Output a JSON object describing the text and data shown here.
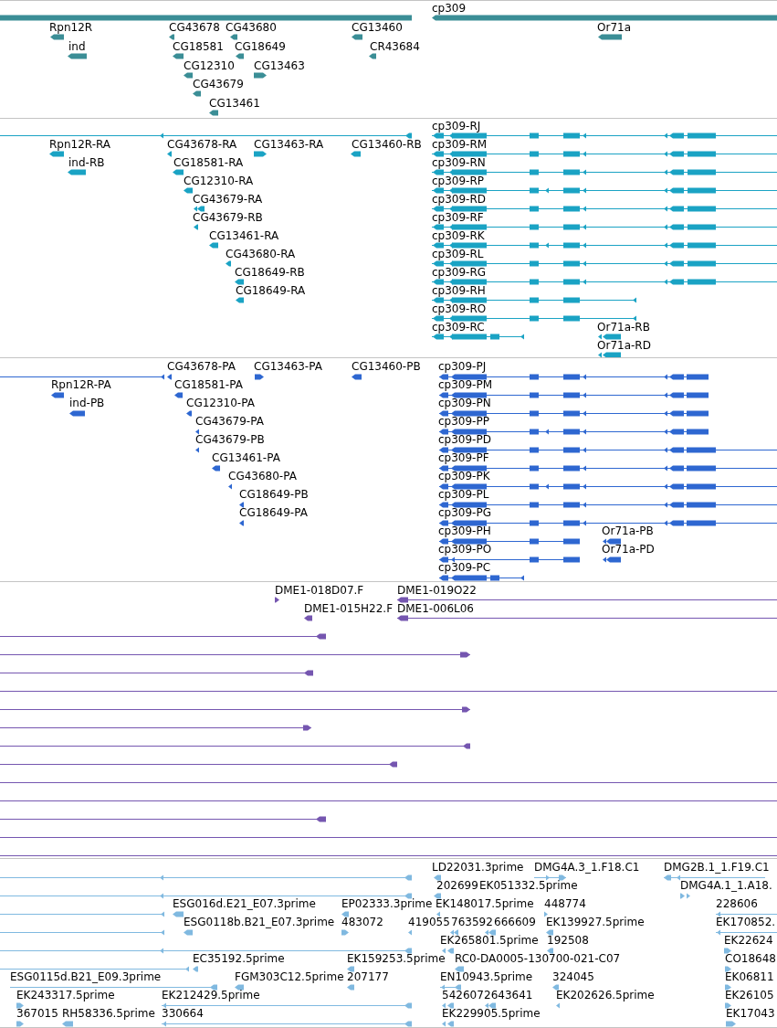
{
  "tracks": [
    {
      "color": "#3b8e96",
      "features": [
        {
          "clipped": true
        },
        {
          "label": "cp309",
          "reverse": true
        },
        {
          "label": "Rpn12R",
          "reverse": true
        },
        {
          "label": "CG43678",
          "reverse": true
        },
        {
          "label": "CG43680",
          "reverse": true
        },
        {
          "label": "CG13460",
          "reverse": true
        },
        {
          "label": "Or71a",
          "reverse": true
        },
        {
          "label": "ind",
          "reverse": true
        },
        {
          "label": "CG18581",
          "reverse": true
        },
        {
          "label": "CG18649",
          "reverse": true
        },
        {
          "label": "CR43684",
          "reverse": true
        },
        {
          "label": "CG12310",
          "reverse": true
        },
        {
          "label": "CG13463",
          "reverse": false
        },
        {
          "label": "CG43679",
          "reverse": true
        },
        {
          "label": "CG13461",
          "reverse": true
        }
      ]
    },
    {
      "color": "#1aa3c4",
      "features": [
        {
          "reverse": true
        },
        {
          "label": "cp309-RJ",
          "reverse": true
        },
        {
          "label": "Rpn12R-RA",
          "reverse": true
        },
        {
          "label": "CG43678-RA",
          "reverse": true
        },
        {
          "label": "CG13463-RA",
          "reverse": false
        },
        {
          "label": "CG13460-RB",
          "reverse": true
        },
        {
          "label": "cp309-RM",
          "reverse": true
        },
        {
          "label": "ind-RB",
          "reverse": true
        },
        {
          "label": "CG18581-RA",
          "reverse": true
        },
        {
          "label": "cp309-RN",
          "reverse": true
        },
        {
          "label": "CG12310-RA",
          "reverse": true
        },
        {
          "label": "cp309-RP",
          "reverse": true
        },
        {
          "label": "CG43679-RA",
          "reverse": true
        },
        {
          "label": "cp309-RD",
          "reverse": true
        },
        {
          "label": "CG43679-RB",
          "reverse": true
        },
        {
          "label": "cp309-RF",
          "reverse": true
        },
        {
          "label": "CG13461-RA",
          "reverse": true
        },
        {
          "label": "cp309-RK",
          "reverse": true
        },
        {
          "label": "CG43680-RA",
          "reverse": true
        },
        {
          "label": "cp309-RL",
          "reverse": true
        },
        {
          "label": "CG18649-RB",
          "reverse": true
        },
        {
          "label": "cp309-RG",
          "reverse": true
        },
        {
          "label": "CG18649-RA",
          "reverse": true
        },
        {
          "label": "cp309-RH",
          "reverse": true
        },
        {
          "label": "cp309-RO",
          "reverse": true
        },
        {
          "label": "cp309-RC",
          "reverse": true
        },
        {
          "label": "Or71a-RB",
          "reverse": true
        },
        {
          "label": "Or71a-RD",
          "reverse": true
        }
      ]
    },
    {
      "color": "#2e67d1",
      "features": [
        {
          "reverse": true
        },
        {
          "label": "CG43678-PA",
          "reverse": true
        },
        {
          "label": "CG13463-PA",
          "reverse": false
        },
        {
          "label": "CG13460-PB",
          "reverse": true
        },
        {
          "label": "cp309-PJ",
          "reverse": true
        },
        {
          "label": "Rpn12R-PA",
          "reverse": true
        },
        {
          "label": "CG18581-PA",
          "reverse": true
        },
        {
          "label": "cp309-PM",
          "reverse": true
        },
        {
          "label": "ind-PB",
          "reverse": true
        },
        {
          "label": "CG12310-PA",
          "reverse": true
        },
        {
          "label": "cp309-PN",
          "reverse": true
        },
        {
          "label": "CG43679-PA",
          "reverse": true
        },
        {
          "label": "cp309-PP",
          "reverse": true
        },
        {
          "label": "CG43679-PB",
          "reverse": true
        },
        {
          "label": "cp309-PD",
          "reverse": true
        },
        {
          "label": "CG13461-PA",
          "reverse": true
        },
        {
          "label": "cp309-PF",
          "reverse": true
        },
        {
          "label": "CG43680-PA",
          "reverse": true
        },
        {
          "label": "cp309-PK",
          "reverse": true
        },
        {
          "label": "CG18649-PB",
          "reverse": true
        },
        {
          "label": "cp309-PL",
          "reverse": true
        },
        {
          "label": "CG18649-PA",
          "reverse": true
        },
        {
          "label": "cp309-PG",
          "reverse": true
        },
        {
          "label": "cp309-PH",
          "reverse": true
        },
        {
          "label": "Or71a-PB",
          "reverse": true
        },
        {
          "label": "cp309-PO",
          "reverse": true
        },
        {
          "label": "Or71a-PD",
          "reverse": true
        },
        {
          "label": "cp309-PC",
          "reverse": true
        }
      ]
    },
    {
      "color": "#7556b0",
      "features": [
        {
          "label": "DME1-018D07.F",
          "reverse": false
        },
        {
          "label": "DME1-019O22",
          "reverse": true
        },
        {
          "label": "DME1-015H22.F",
          "reverse": true
        },
        {
          "label": "DME1-006L06",
          "reverse": true
        },
        {
          "reverse": true
        },
        {
          "reverse": false
        },
        {
          "reverse": true
        },
        {
          "clipped": true
        },
        {
          "reverse": false
        },
        {
          "reverse": false
        },
        {
          "reverse": true
        },
        {
          "reverse": true
        },
        {
          "clipped": true
        },
        {
          "clipped": true
        },
        {
          "reverse": true
        },
        {
          "clipped": true
        },
        {
          "clipped": true
        }
      ]
    },
    {
      "color": "#80b9e0",
      "features": [
        {
          "reverse": true
        },
        {
          "label": "LD22031.3prime",
          "reverse": true
        },
        {
          "label": "DMG4A.3_1.F18.C1",
          "reverse": false
        },
        {
          "label": "DMG2B.1_1.F19.C1",
          "reverse": true
        },
        {
          "reverse": true
        },
        {
          "label": "202699",
          "reverse": true
        },
        {
          "label": "EK051332.5prime"
        },
        {
          "label": "DMG4A.1_1.A18.",
          "reverse": false
        },
        {
          "reverse": true
        },
        {
          "label": "ESG016d.E21_E07.3prime",
          "reverse": true
        },
        {
          "label": "EP02333.3prime",
          "reverse": true
        },
        {
          "label": "EK148017.5prime",
          "reverse": true
        },
        {
          "label": "448774",
          "reverse": false
        },
        {
          "label": "228606",
          "reverse": true
        },
        {
          "reverse": true
        },
        {
          "label": "ESG0118b.B21_E07.3prime",
          "reverse": true
        },
        {
          "label": "483072",
          "reverse": false
        },
        {
          "label": "419055",
          "reverse": true
        },
        {
          "label": "763592",
          "reverse": true
        },
        {
          "label": "666609",
          "reverse": true
        },
        {
          "label": "EK139927.5prime",
          "reverse": true
        },
        {
          "label": "EK170852.",
          "reverse": true
        },
        {
          "reverse": true
        },
        {
          "label": "EK265801.5prime",
          "reverse": true
        },
        {
          "label": "192508",
          "reverse": true
        },
        {
          "label": "EK22624",
          "reverse": false
        },
        {
          "reverse": true
        },
        {
          "label": "EC35192.5prime",
          "reverse": true
        },
        {
          "label": "EK159253.5prime",
          "reverse": true
        },
        {
          "label": "RC0-DA0005-130700-021-C07",
          "reverse": true
        },
        {
          "label": "CO18648",
          "reverse": false
        },
        {
          "label": "ESG0115d.B21_E09.3prime",
          "reverse": true
        },
        {
          "label": "FGM303C12.5prime",
          "reverse": true
        },
        {
          "label": "207177",
          "reverse": true
        },
        {
          "label": "EN10943.5prime",
          "reverse": true
        },
        {
          "label": "324045",
          "reverse": true
        },
        {
          "label": "EK06811",
          "reverse": false
        },
        {
          "label": "EK243317.5prime",
          "reverse": false
        },
        {
          "label": "EK212429.5prime",
          "reverse": true
        },
        {
          "label": "542607",
          "reverse": true
        },
        {
          "label": "2643641",
          "reverse": true
        },
        {
          "label": "EK202626.5prime",
          "reverse": true
        },
        {
          "label": "EK26105",
          "reverse": false
        },
        {
          "label": "367015",
          "reverse": false
        },
        {
          "label": "RH58336.5prime",
          "reverse": true
        },
        {
          "label": "330664",
          "reverse": true
        },
        {
          "label": "EK229905.5prime",
          "reverse": true
        },
        {
          "label": "EK17043",
          "reverse": false
        }
      ]
    }
  ]
}
